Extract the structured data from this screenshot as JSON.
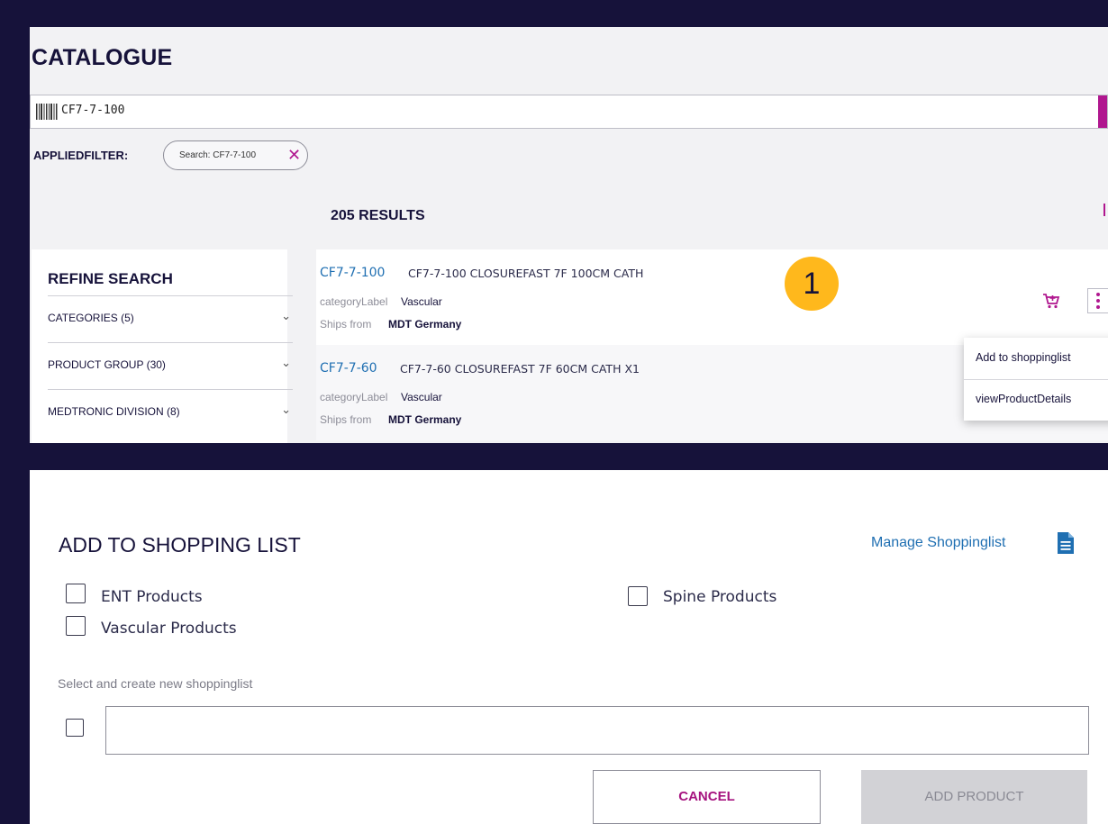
{
  "catalogue": {
    "title": "CATALOGUE",
    "search_value": "CF7-7-100",
    "applied_filter_label": "APPLIEDFILTER:",
    "filter_chip_text": "Search: CF7-7-100",
    "filter_chip_remove": "✕",
    "results_count": "205 RESULTS"
  },
  "refine": {
    "title": "REFINE SEARCH",
    "facets": [
      {
        "label": "CATEGORIES (5)"
      },
      {
        "label": "PRODUCT GROUP (30)"
      },
      {
        "label": "MEDTRONIC DIVISION (8)"
      }
    ],
    "chevron": "⌄"
  },
  "results": [
    {
      "code": "CF7-7-100",
      "description": "CF7-7-100 CLOSUREFAST 7F 100CM CATH",
      "category_label": "categoryLabel",
      "category_value": "Vascular",
      "ships_label": "Ships from",
      "ships_value": "MDT Germany"
    },
    {
      "code": "CF7-7-60",
      "description": "CF7-7-60 CLOSUREFAST 7F 60CM CATH X1",
      "category_label": "categoryLabel",
      "category_value": "Vascular",
      "ships_label": "Ships from",
      "ships_value": "MDT Germany"
    }
  ],
  "context_menu": {
    "items": [
      {
        "label": "Add to shoppinglist"
      },
      {
        "label": "viewProductDetails"
      }
    ]
  },
  "step_badge": "1",
  "dialog": {
    "title": "ADD TO SHOPPING LIST",
    "manage_link": "Manage Shoppinglist",
    "lists": [
      {
        "label": "ENT Products",
        "checked": false
      },
      {
        "label": "Spine Products",
        "checked": false
      },
      {
        "label": "Vascular Products",
        "checked": false
      }
    ],
    "new_list_hint": "Select and create new shoppinglist",
    "new_list_value": "",
    "cancel_label": "CANCEL",
    "add_label": "ADD PRODUCT"
  },
  "colors": {
    "background": "#16123a",
    "accent_magenta": "#b0178f",
    "link_blue": "#1f6fb2",
    "badge_yellow": "#ffb81c",
    "disabled_gray": "#d2d2d6"
  },
  "icons": [
    "barcode-icon",
    "remove-filter-icon",
    "chevron-down-icon",
    "cart-icon",
    "more-vertical-icon",
    "document-icon"
  ]
}
